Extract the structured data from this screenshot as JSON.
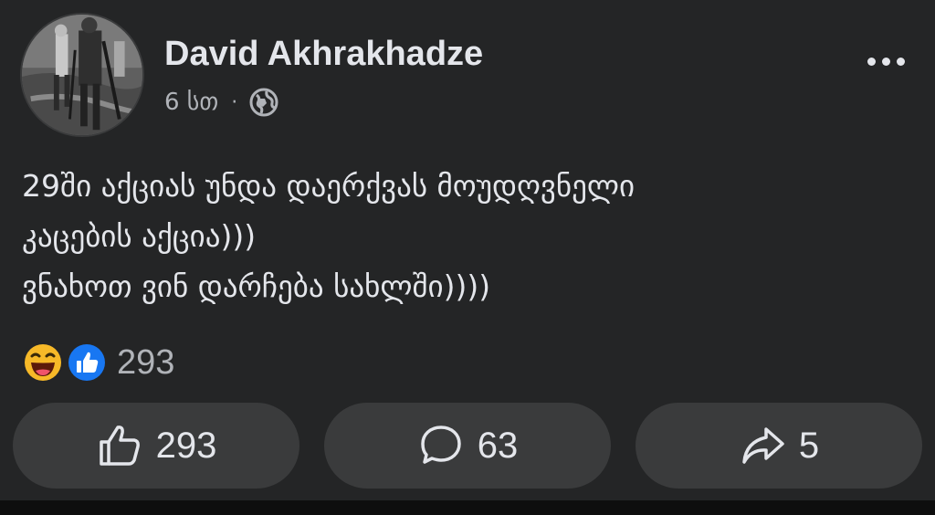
{
  "post": {
    "author_name": "David Akhrakhadze",
    "timestamp": "6 სთ",
    "meta_separator": "·",
    "privacy_icon": "globe-icon",
    "more_icon": "more-options-icon",
    "text_lines": [
      "29ში აქციას უნდა დაერქვას მოუდღვნელი",
      "კაცების აქცია)))",
      "ვნახოთ ვინ დარჩება სახლში))))"
    ]
  },
  "reactions": {
    "icons": [
      "haha-reaction-icon",
      "like-reaction-icon"
    ],
    "count": "293"
  },
  "actions": {
    "like_count": "293",
    "comment_count": "63",
    "share_count": "5"
  },
  "colors": {
    "background": "#242526",
    "button_bg": "#3a3b3c",
    "text_primary": "#e4e6eb",
    "text_secondary": "#b0b3b8",
    "like_blue": "#1877f2",
    "haha_yellow": "#f7b928"
  }
}
